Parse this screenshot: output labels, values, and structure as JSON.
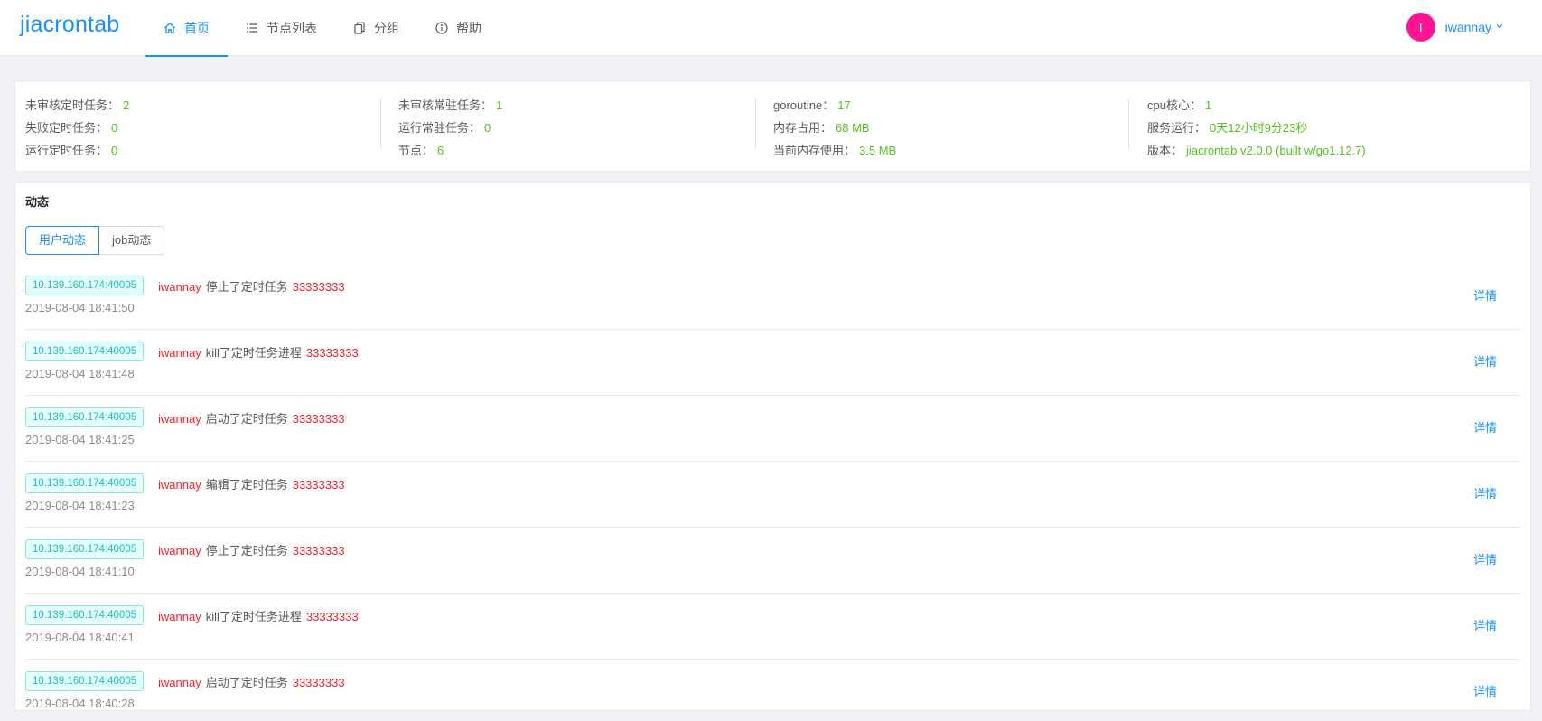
{
  "app": {
    "logo": "jiacrontab"
  },
  "nav": [
    {
      "label": "首页",
      "icon": "home-icon",
      "active": true
    },
    {
      "label": "节点列表",
      "icon": "list-icon",
      "active": false
    },
    {
      "label": "分组",
      "icon": "copy-icon",
      "active": false
    },
    {
      "label": "帮助",
      "icon": "info-icon",
      "active": false
    }
  ],
  "user": {
    "avatar_letter": "I",
    "name": "iwannay",
    "avatar_color": "#ff1493"
  },
  "stats": {
    "col1": [
      {
        "label": "未审核定时任务：",
        "value": "2"
      },
      {
        "label": "失败定时任务：",
        "value": "0"
      },
      {
        "label": "运行定时任务：",
        "value": "0"
      }
    ],
    "col2": [
      {
        "label": "未审核常驻任务：",
        "value": "1"
      },
      {
        "label": "运行常驻任务：",
        "value": "0"
      },
      {
        "label": "节点：",
        "value": "6"
      }
    ],
    "col3": [
      {
        "label": "goroutine：",
        "value": "17"
      },
      {
        "label": "内存占用：",
        "value": "68 MB"
      },
      {
        "label": "当前内存使用：",
        "value": "3.5 MB"
      }
    ],
    "col4": [
      {
        "label": "cpu核心：",
        "value": "1"
      },
      {
        "label": "服务运行：",
        "value": "0天12小时9分23秒"
      },
      {
        "label": "版本：",
        "value": "jiacrontab v2.0.0 (built w/go1.12.7)"
      }
    ]
  },
  "activity": {
    "title": "动态",
    "tabs": [
      {
        "label": "用户动态",
        "active": true
      },
      {
        "label": "job动态",
        "active": false
      }
    ],
    "detail_label": "详情",
    "rows": [
      {
        "addr": "10.139.160.174:40005",
        "user": "iwannay",
        "action": "停止了定时任务",
        "job": "33333333",
        "time": "2019-08-04 18:41:50"
      },
      {
        "addr": "10.139.160.174:40005",
        "user": "iwannay",
        "action": "kill了定时任务进程",
        "job": "33333333",
        "time": "2019-08-04 18:41:48"
      },
      {
        "addr": "10.139.160.174:40005",
        "user": "iwannay",
        "action": "启动了定时任务",
        "job": "33333333",
        "time": "2019-08-04 18:41:25"
      },
      {
        "addr": "10.139.160.174:40005",
        "user": "iwannay",
        "action": "编辑了定时任务",
        "job": "33333333",
        "time": "2019-08-04 18:41:23"
      },
      {
        "addr": "10.139.160.174:40005",
        "user": "iwannay",
        "action": "停止了定时任务",
        "job": "33333333",
        "time": "2019-08-04 18:41:10"
      },
      {
        "addr": "10.139.160.174:40005",
        "user": "iwannay",
        "action": "kill了定时任务进程",
        "job": "33333333",
        "time": "2019-08-04 18:40:41"
      },
      {
        "addr": "10.139.160.174:40005",
        "user": "iwannay",
        "action": "启动了定时任务",
        "job": "33333333",
        "time": "2019-08-04 18:40:28"
      }
    ]
  }
}
